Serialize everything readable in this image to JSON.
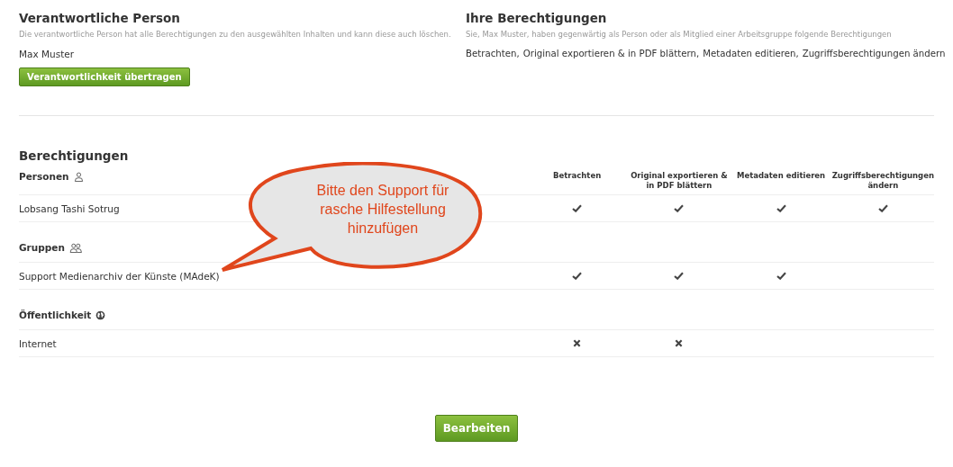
{
  "responsible": {
    "title": "Verantwortliche Person",
    "description": "Die verantwortliche Person hat alle Berechtigungen zu den ausgewählten Inhalten und kann diese auch löschen.",
    "name": "Max Muster",
    "button": "Verantwortlichkeit übertragen"
  },
  "your_permissions": {
    "title": "Ihre Berechtigungen",
    "description": "Sie, Max Muster, haben gegenwärtig als Person oder als Mitglied einer Arbeitsgruppe folgende Berechtigungen",
    "items": [
      "Betrachten,",
      "Original exportieren & in PDF blättern,",
      "Metadaten editieren,",
      "Zugriffsberechtigungen ändern"
    ]
  },
  "permissions": {
    "title": "Berechtigungen",
    "columns": [
      "Betrachten",
      "Original exportieren & in PDF blättern",
      "Metadaten editieren",
      "Zugriffsberechtigungen ändern"
    ],
    "sections": [
      {
        "title": "Personen",
        "kind": "person",
        "rows": [
          {
            "name": "Lobsang Tashi Sotrug",
            "cells": [
              {
                "kind": "check"
              },
              {
                "kind": "check"
              },
              {
                "kind": "check"
              },
              {
                "kind": "check"
              }
            ]
          }
        ]
      },
      {
        "title": "Gruppen",
        "kind": "group",
        "rows": [
          {
            "name": "Support Medienarchiv der Künste (MAdeK)",
            "cells": [
              {
                "kind": "check"
              },
              {
                "kind": "check"
              },
              {
                "kind": "check"
              },
              {
                "kind": "empty"
              }
            ]
          }
        ]
      },
      {
        "title": "Öffentlichkeit",
        "kind": "public",
        "rows": [
          {
            "name": "Internet",
            "cells": [
              {
                "kind": "cross"
              },
              {
                "kind": "cross"
              },
              {
                "kind": "empty"
              },
              {
                "kind": "empty"
              }
            ]
          }
        ]
      }
    ]
  },
  "callout": {
    "lines": [
      "Bitte den Support für",
      "rasche Hilfestellung",
      "hinzufügen"
    ]
  },
  "edit_button": "Bearbeiten"
}
